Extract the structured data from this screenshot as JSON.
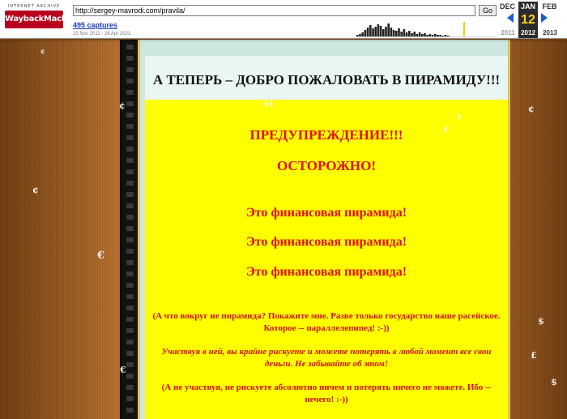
{
  "toolbar": {
    "logo_top": "INTERNET ARCHIVE",
    "logo_main": "WaybackMachine",
    "url": "http://sergey-mavrodi.com/pravila/",
    "go_label": "Go",
    "captures": "495 captures",
    "captures_range": "15 Nov 2011 - 28 Apr 2021",
    "prev_month": "DEC",
    "cur_month": "JAN",
    "next_month": "FEB",
    "cur_day": "12",
    "prev_year": "2011",
    "cur_year": "2012",
    "next_year": "2013"
  },
  "page": {
    "title": "А ТЕПЕРЬ – ДОБРО ПОЖАЛОВАТЬ В ПИРАМИДУ!!!",
    "warning_1": "ПРЕДУПРЕЖДЕНИЕ!!!",
    "warning_2": "ОСТОРОЖНО!",
    "pyramid_lines": [
      "Это финансовая пирамида!",
      "Это финансовая пирамида!",
      "Это финансовая пирамида!"
    ],
    "para_1": "(А что вокруг не пирамида? Покажите мне. Разве только государство наше расейское. Которое -- параллелепипед! :-))",
    "para_2": "Участвуя в ней, вы крайне рискуете и можете потерять в любой момент все свои деньги. Не забывайте об этом!",
    "para_3": "(А не участвуя, не рискуете абсолютно ничем и потерять ничего не можете. Ибо -- нечего! :-))"
  },
  "colors": {
    "warning_red": "#e01010",
    "yellow_bg": "#ffff00",
    "wayback_red": "#b8001e",
    "nav_blue": "#1a5ecf"
  }
}
